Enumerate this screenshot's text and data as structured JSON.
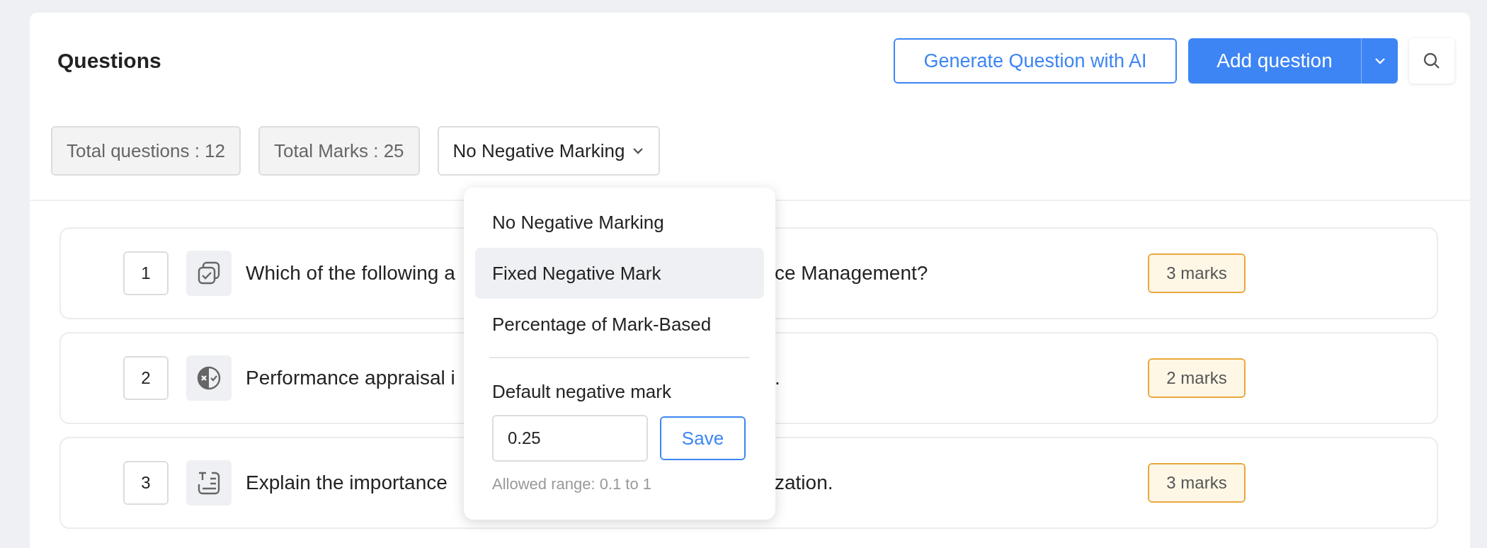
{
  "title": "Questions",
  "actions": {
    "generate_button": "Generate Question with AI",
    "add_button": "Add question"
  },
  "stats": [
    "Total questions : 12",
    "Total Marks : 25"
  ],
  "marking_dropdown": {
    "value": "No Negative Marking",
    "expanded": true,
    "options": [
      {
        "label": "No Negative Marking",
        "highlighted": false
      },
      {
        "label": "Fixed Negative Mark",
        "highlighted": true
      },
      {
        "label": "Percentage of Mark-Based",
        "highlighted": false
      }
    ],
    "default_label": "Default negative mark",
    "input_value": "0.25",
    "save_button": "Save",
    "hint": "Allowed range: 0.1 to 1"
  },
  "questions": [
    {
      "number": "1",
      "kind": "multiple-choice",
      "text_start": "Which of the following a",
      "text_end": "ce Management?",
      "marks": "3 marks"
    },
    {
      "number": "2",
      "kind": "true-false",
      "text_start": "Performance appraisal i",
      "text_end": ".",
      "marks": "2 marks"
    },
    {
      "number": "3",
      "kind": "text",
      "text_start": "Explain the importance",
      "text_end": "zation.",
      "marks": "3 marks"
    }
  ]
}
